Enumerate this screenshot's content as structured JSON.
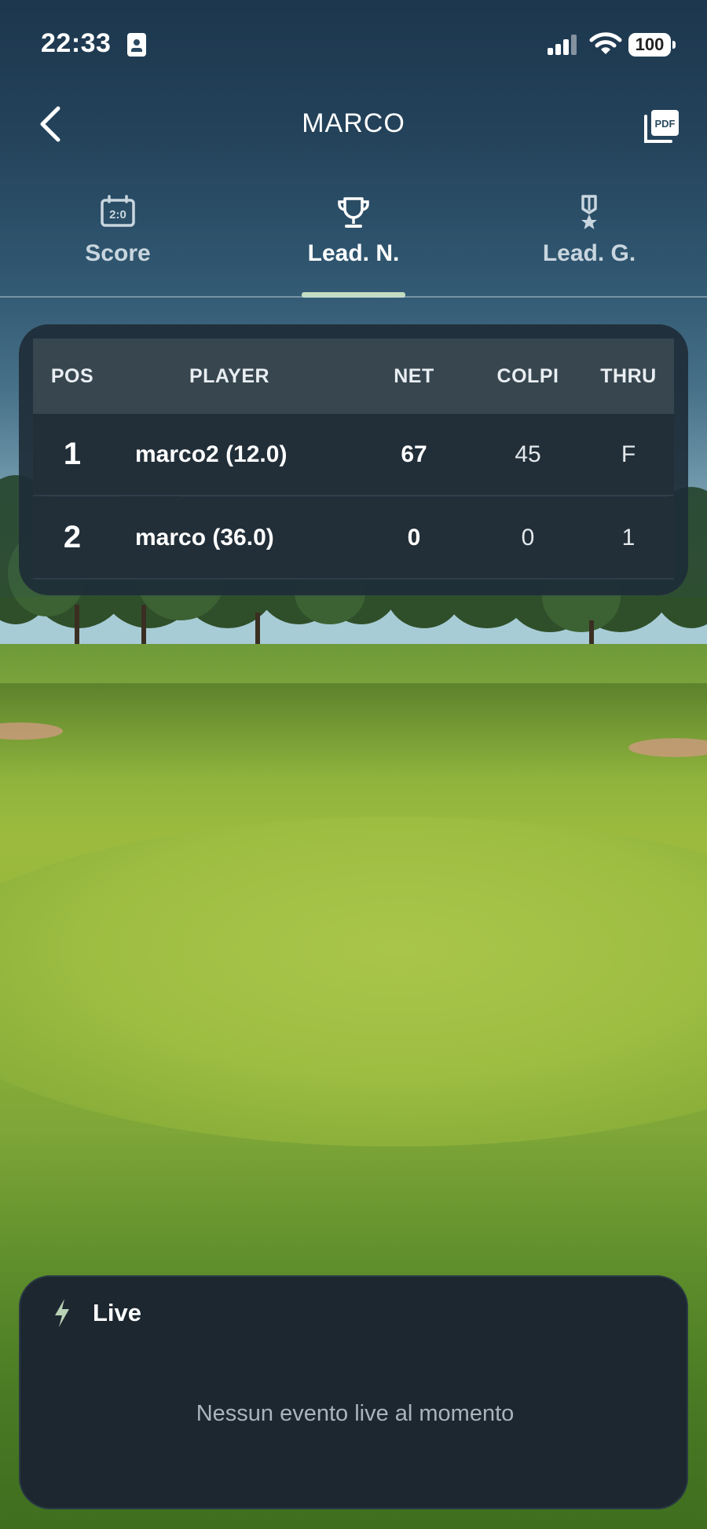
{
  "status_bar": {
    "time": "22:33",
    "battery": "100"
  },
  "header": {
    "title": "MARCO",
    "back_icon": "chevron-left-icon",
    "pdf_icon": "pdf-icon"
  },
  "tabs": [
    {
      "label": "Score",
      "icon": "scoreboard-icon",
      "active": false
    },
    {
      "label": "Lead. N.",
      "icon": "trophy-icon",
      "active": true
    },
    {
      "label": "Lead. G.",
      "icon": "medal-icon",
      "active": false
    }
  ],
  "leaderboard": {
    "columns": {
      "pos": "POS",
      "player": "PLAYER",
      "net": "NET",
      "colpi": "COLPI",
      "thru": "THRU"
    },
    "rows": [
      {
        "pos": "1",
        "player": "marco2 (12.0)",
        "net": "67",
        "colpi": "45",
        "thru": "F"
      },
      {
        "pos": "2",
        "player": "marco (36.0)",
        "net": "0",
        "colpi": "0",
        "thru": "1"
      }
    ]
  },
  "live": {
    "icon": "bolt-icon",
    "title": "Live",
    "empty_message": "Nessun evento live al momento"
  },
  "colors": {
    "tab_indicator": "#c4dcc0",
    "card_background": "#1e2c37",
    "accent_icon": "#b9d1b5"
  }
}
